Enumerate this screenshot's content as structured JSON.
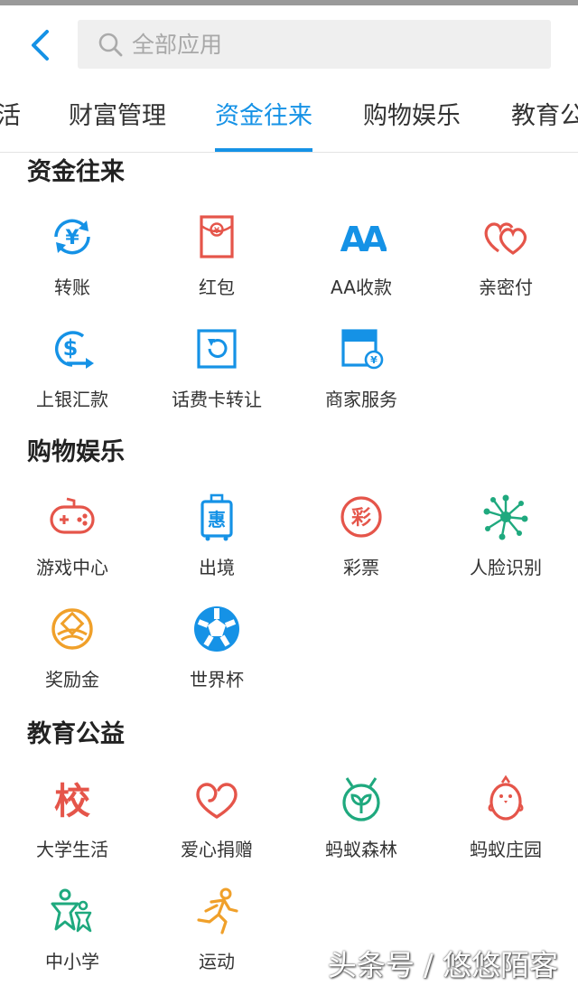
{
  "search": {
    "placeholder": "全部应用"
  },
  "tabs": [
    "活",
    "财富管理",
    "资金往来",
    "购物娱乐",
    "教育公"
  ],
  "sections": [
    {
      "title": "资金往来",
      "apps": [
        {
          "label": "转账",
          "icon": "transfer-icon"
        },
        {
          "label": "红包",
          "icon": "red-packet-icon"
        },
        {
          "label": "AA收款",
          "icon": "aa-icon"
        },
        {
          "label": "亲密付",
          "icon": "hearts-icon"
        },
        {
          "label": "上银汇款",
          "icon": "remittance-icon"
        },
        {
          "label": "话费卡转让",
          "icon": "card-transfer-icon"
        },
        {
          "label": "商家服务",
          "icon": "merchant-icon"
        }
      ]
    },
    {
      "title": "购物娱乐",
      "apps": [
        {
          "label": "游戏中心",
          "icon": "gamepad-icon"
        },
        {
          "label": "出境",
          "icon": "luggage-icon"
        },
        {
          "label": "彩票",
          "icon": "lottery-icon"
        },
        {
          "label": "人脸识别",
          "icon": "face-dots-icon"
        },
        {
          "label": "奖励金",
          "icon": "reward-icon"
        },
        {
          "label": "世界杯",
          "icon": "soccer-ball-icon"
        }
      ]
    },
    {
      "title": "教育公益",
      "apps": [
        {
          "label": "大学生活",
          "icon": "school-icon"
        },
        {
          "label": "爱心捐赠",
          "icon": "heart-icon"
        },
        {
          "label": "蚂蚁森林",
          "icon": "sprout-icon"
        },
        {
          "label": "蚂蚁庄园",
          "icon": "chick-icon"
        },
        {
          "label": "中小学",
          "icon": "kids-icon"
        },
        {
          "label": "运动",
          "icon": "runner-icon"
        }
      ]
    }
  ],
  "glyphs": {
    "lottery": "彩",
    "school": "校",
    "luggage": "惠",
    "yen": "¥",
    "dollar": "$",
    "aa": "AA"
  },
  "watermark": "头条号 / 悠悠陌客",
  "colors": {
    "accent": "#1592e6",
    "red": "#e5554a",
    "orange": "#f0a02a",
    "green": "#1fa97e"
  }
}
